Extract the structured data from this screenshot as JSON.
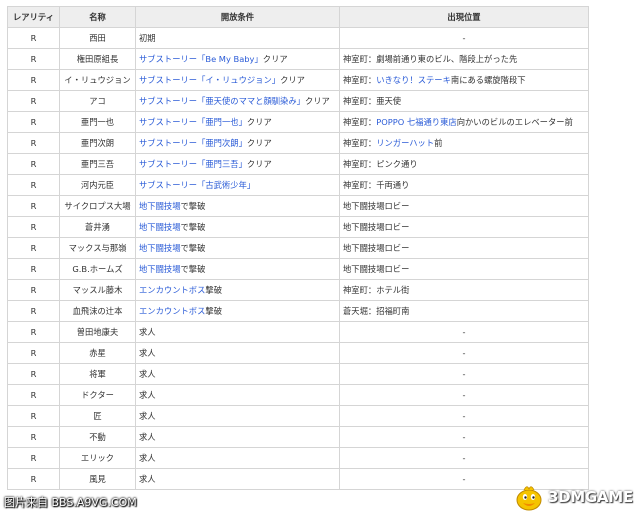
{
  "table": {
    "headers": [
      "レアリティ",
      "名称",
      "開放条件",
      "出現位置"
    ],
    "rows": [
      {
        "rarity": "R",
        "name": "西田",
        "cond": [
          {
            "t": "初期",
            "link": false
          }
        ],
        "loc": [
          {
            "t": "-",
            "link": false
          }
        ],
        "locCenter": true
      },
      {
        "rarity": "R",
        "name": "権田原組長",
        "cond": [
          {
            "t": "サブストーリー「Be My Baby」",
            "link": true
          },
          {
            "t": "クリア",
            "link": false
          }
        ],
        "loc": [
          {
            "t": "神室町：劇場前通り東のビル、階段上がった先",
            "link": false
          }
        ],
        "locCenter": false
      },
      {
        "rarity": "R",
        "name": "イ・リュウジョン",
        "cond": [
          {
            "t": "サブストーリー「イ・リュウジョン」",
            "link": true
          },
          {
            "t": "クリア",
            "link": false
          }
        ],
        "loc": [
          {
            "t": "神室町：",
            "link": false
          },
          {
            "t": "いきなり！ステーキ",
            "link": true
          },
          {
            "t": "南にある螺旋階段下",
            "link": false
          }
        ],
        "locCenter": false
      },
      {
        "rarity": "R",
        "name": "アコ",
        "cond": [
          {
            "t": "サブストーリー「亜天使のママと顔馴染み」",
            "link": true
          },
          {
            "t": "クリア",
            "link": false
          }
        ],
        "loc": [
          {
            "t": "神室町：亜天使",
            "link": false
          }
        ],
        "locCenter": false
      },
      {
        "rarity": "R",
        "name": "亜門一也",
        "cond": [
          {
            "t": "サブストーリー「亜門一也」",
            "link": true
          },
          {
            "t": "クリア",
            "link": false
          }
        ],
        "loc": [
          {
            "t": "神室町：",
            "link": false
          },
          {
            "t": "POPPO 七福通り東店",
            "link": true
          },
          {
            "t": "向かいのビルのエレベーター前",
            "link": false
          }
        ],
        "locCenter": false
      },
      {
        "rarity": "R",
        "name": "亜門次朗",
        "cond": [
          {
            "t": "サブストーリー「亜門次朗」",
            "link": true
          },
          {
            "t": "クリア",
            "link": false
          }
        ],
        "loc": [
          {
            "t": "神室町：",
            "link": false
          },
          {
            "t": "リンガーハット",
            "link": true
          },
          {
            "t": "前",
            "link": false
          }
        ],
        "locCenter": false
      },
      {
        "rarity": "R",
        "name": "亜門三吾",
        "cond": [
          {
            "t": "サブストーリー「亜門三吾」",
            "link": true
          },
          {
            "t": "クリア",
            "link": false
          }
        ],
        "loc": [
          {
            "t": "神室町：ピンク通り",
            "link": false
          }
        ],
        "locCenter": false
      },
      {
        "rarity": "R",
        "name": "河内元臣",
        "cond": [
          {
            "t": "サブストーリー「古武術少年」",
            "link": true
          }
        ],
        "loc": [
          {
            "t": "神室町：千両通り",
            "link": false
          }
        ],
        "locCenter": false
      },
      {
        "rarity": "R",
        "name": "サイクロプス大場",
        "cond": [
          {
            "t": "地下闘技場",
            "link": true
          },
          {
            "t": "で撃破",
            "link": false
          }
        ],
        "loc": [
          {
            "t": "地下闘技場ロビー",
            "link": false
          }
        ],
        "locCenter": false
      },
      {
        "rarity": "R",
        "name": "蒼井湧",
        "cond": [
          {
            "t": "地下闘技場",
            "link": true
          },
          {
            "t": "で撃破",
            "link": false
          }
        ],
        "loc": [
          {
            "t": "地下闘技場ロビー",
            "link": false
          }
        ],
        "locCenter": false
      },
      {
        "rarity": "R",
        "name": "マックス与那嶺",
        "cond": [
          {
            "t": "地下闘技場",
            "link": true
          },
          {
            "t": "で撃破",
            "link": false
          }
        ],
        "loc": [
          {
            "t": "地下闘技場ロビー",
            "link": false
          }
        ],
        "locCenter": false
      },
      {
        "rarity": "R",
        "name": "G.B.ホームズ",
        "cond": [
          {
            "t": "地下闘技場",
            "link": true
          },
          {
            "t": "で撃破",
            "link": false
          }
        ],
        "loc": [
          {
            "t": "地下闘技場ロビー",
            "link": false
          }
        ],
        "locCenter": false
      },
      {
        "rarity": "R",
        "name": "マッスル藤木",
        "cond": [
          {
            "t": "エンカウントボス",
            "link": true
          },
          {
            "t": "撃破",
            "link": false
          }
        ],
        "loc": [
          {
            "t": "神室町：ホテル街",
            "link": false
          }
        ],
        "locCenter": false
      },
      {
        "rarity": "R",
        "name": "血飛沫の辻本",
        "cond": [
          {
            "t": "エンカウントボス",
            "link": true
          },
          {
            "t": "撃破",
            "link": false
          }
        ],
        "loc": [
          {
            "t": "蒼天堀：招福町南",
            "link": false
          }
        ],
        "locCenter": false
      },
      {
        "rarity": "R",
        "name": "曽田地康夫",
        "cond": [
          {
            "t": "求人",
            "link": false
          }
        ],
        "loc": [
          {
            "t": "-",
            "link": false
          }
        ],
        "locCenter": true
      },
      {
        "rarity": "R",
        "name": "赤星",
        "cond": [
          {
            "t": "求人",
            "link": false
          }
        ],
        "loc": [
          {
            "t": "-",
            "link": false
          }
        ],
        "locCenter": true
      },
      {
        "rarity": "R",
        "name": "将軍",
        "cond": [
          {
            "t": "求人",
            "link": false
          }
        ],
        "loc": [
          {
            "t": "-",
            "link": false
          }
        ],
        "locCenter": true
      },
      {
        "rarity": "R",
        "name": "ドクター",
        "cond": [
          {
            "t": "求人",
            "link": false
          }
        ],
        "loc": [
          {
            "t": "-",
            "link": false
          }
        ],
        "locCenter": true
      },
      {
        "rarity": "R",
        "name": "匠",
        "cond": [
          {
            "t": "求人",
            "link": false
          }
        ],
        "loc": [
          {
            "t": "-",
            "link": false
          }
        ],
        "locCenter": true
      },
      {
        "rarity": "R",
        "name": "不動",
        "cond": [
          {
            "t": "求人",
            "link": false
          }
        ],
        "loc": [
          {
            "t": "-",
            "link": false
          }
        ],
        "locCenter": true
      },
      {
        "rarity": "R",
        "name": "エリック",
        "cond": [
          {
            "t": "求人",
            "link": false
          }
        ],
        "loc": [
          {
            "t": "-",
            "link": false
          }
        ],
        "locCenter": true
      },
      {
        "rarity": "R",
        "name": "風見",
        "cond": [
          {
            "t": "求人",
            "link": false
          }
        ],
        "loc": [
          {
            "t": "-",
            "link": false
          }
        ],
        "locCenter": true
      }
    ]
  },
  "footer": {
    "credit": "图片来自 BBS.A9VG.COM",
    "logo_text": "3DMGAME",
    "logo_icon": "duck-mascot-icon",
    "link_color": "#2a5bd7"
  }
}
